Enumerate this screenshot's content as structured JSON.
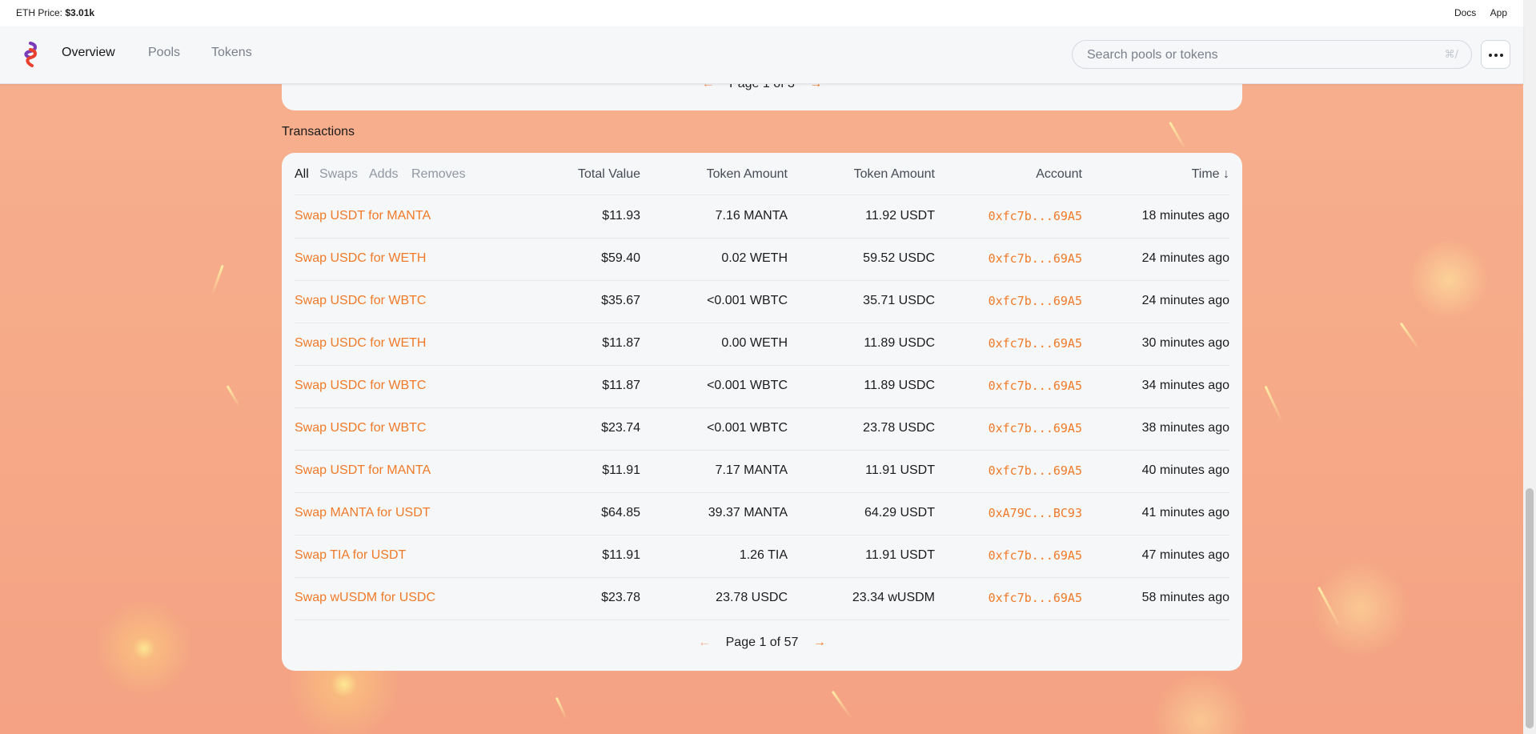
{
  "topbar": {
    "eth_label": "ETH Price:",
    "eth_value": "$3.01k",
    "links": [
      "Docs",
      "App"
    ]
  },
  "nav": {
    "items": [
      "Overview",
      "Pools",
      "Tokens"
    ],
    "active": "Overview"
  },
  "search": {
    "placeholder": "Search pools or tokens",
    "shortcut": "⌘/"
  },
  "top_pager": {
    "text": "Page 1 of 3",
    "prev": "←",
    "next": "→"
  },
  "transactions": {
    "title": "Transactions",
    "filters": [
      "All",
      "Swaps",
      "Adds",
      "Removes"
    ],
    "columns": [
      "Total Value",
      "Token Amount",
      "Token Amount",
      "Account",
      "Time ↓"
    ],
    "rows": [
      {
        "desc": "Swap USDT for MANTA",
        "total": "$11.93",
        "amt1": "7.16 MANTA",
        "amt2": "11.92 USDT",
        "account": "0xfc7b...69A5",
        "time": "18 minutes ago"
      },
      {
        "desc": "Swap USDC for WETH",
        "total": "$59.40",
        "amt1": "0.02 WETH",
        "amt2": "59.52 USDC",
        "account": "0xfc7b...69A5",
        "time": "24 minutes ago"
      },
      {
        "desc": "Swap USDC for WBTC",
        "total": "$35.67",
        "amt1": "<0.001 WBTC",
        "amt2": "35.71 USDC",
        "account": "0xfc7b...69A5",
        "time": "24 minutes ago"
      },
      {
        "desc": "Swap USDC for WETH",
        "total": "$11.87",
        "amt1": "0.00 WETH",
        "amt2": "11.89 USDC",
        "account": "0xfc7b...69A5",
        "time": "30 minutes ago"
      },
      {
        "desc": "Swap USDC for WBTC",
        "total": "$11.87",
        "amt1": "<0.001 WBTC",
        "amt2": "11.89 USDC",
        "account": "0xfc7b...69A5",
        "time": "34 minutes ago"
      },
      {
        "desc": "Swap USDC for WBTC",
        "total": "$23.74",
        "amt1": "<0.001 WBTC",
        "amt2": "23.78 USDC",
        "account": "0xfc7b...69A5",
        "time": "38 minutes ago"
      },
      {
        "desc": "Swap USDT for MANTA",
        "total": "$11.91",
        "amt1": "7.17 MANTA",
        "amt2": "11.91 USDT",
        "account": "0xfc7b...69A5",
        "time": "40 minutes ago"
      },
      {
        "desc": "Swap MANTA for USDT",
        "total": "$64.85",
        "amt1": "39.37 MANTA",
        "amt2": "64.29 USDT",
        "account": "0xA79C...BC93",
        "time": "41 minutes ago"
      },
      {
        "desc": "Swap TIA for USDT",
        "total": "$11.91",
        "amt1": "1.26 TIA",
        "amt2": "11.91 USDT",
        "account": "0xfc7b...69A5",
        "time": "47 minutes ago"
      },
      {
        "desc": "Swap wUSDM for USDC",
        "total": "$23.78",
        "amt1": "23.78 USDC",
        "amt2": "23.34 wUSDM",
        "account": "0xfc7b...69A5",
        "time": "58 minutes ago"
      }
    ],
    "pager": {
      "text": "Page 1 of 57",
      "prev": "←",
      "next": "→"
    }
  },
  "colors": {
    "accent": "#f07a28",
    "background": "#f6aa88",
    "panel": "#f6f7f9"
  }
}
